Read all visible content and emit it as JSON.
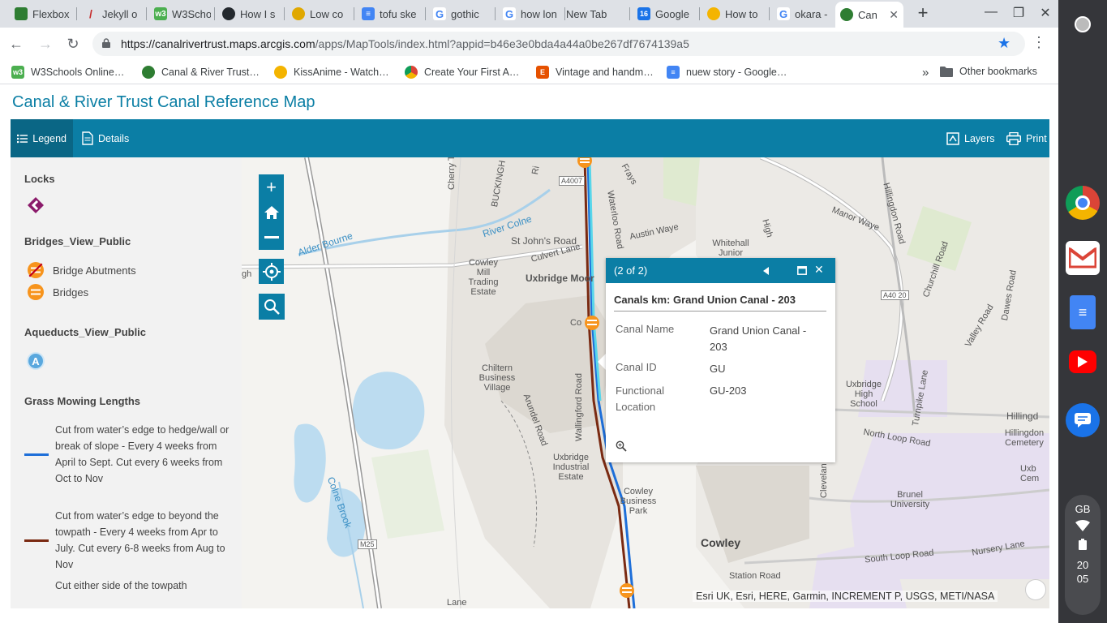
{
  "browser": {
    "tabs": [
      {
        "label": "Flexbox",
        "favicon_color": "#2e7d32"
      },
      {
        "label": "Jekyll o",
        "favicon_color": "#c62828"
      },
      {
        "label": "W3Scho",
        "favicon_color": "#4caf50"
      },
      {
        "label": "How I s",
        "favicon_color": "#24292e"
      },
      {
        "label": "Low co",
        "favicon_color": "#e0a800"
      },
      {
        "label": "tofu ske",
        "favicon_color": "#4285f4"
      },
      {
        "label": "gothic",
        "favicon_color": "#ffffff"
      },
      {
        "label": "how lon",
        "favicon_color": "#ffffff"
      },
      {
        "label": "New Tab",
        "favicon_color": ""
      },
      {
        "label": "Google",
        "favicon_color": "#1a73e8"
      },
      {
        "label": "How to",
        "favicon_color": "#f4b400"
      },
      {
        "label": "okara -",
        "favicon_color": "#ffffff"
      },
      {
        "label": "Can",
        "favicon_color": "#2e7d32",
        "active": true
      }
    ],
    "calendar_fav_text": "16",
    "new_tab_symbol": "+",
    "minimize": "—",
    "maximize": "❐",
    "close": "✕",
    "url_host": "https://canalrivertrust.maps.arcgis.com",
    "url_path": "/apps/MapTools/index.html?appid=b46e3e0bda4a44a0be267df7674139a5",
    "bookmarks": [
      {
        "label": "W3Schools Online…",
        "favicon_color": "#4caf50",
        "glyph": "w3"
      },
      {
        "label": "Canal & River Trust…",
        "favicon_color": "#2e7d32",
        "glyph": ""
      },
      {
        "label": "KissAnime - Watch…",
        "favicon_color": "#f4b400",
        "glyph": ""
      },
      {
        "label": "Create Your First A…",
        "favicon_color": "#db4437",
        "glyph": ""
      },
      {
        "label": "Vintage and handm…",
        "favicon_color": "#e65100",
        "glyph": "E"
      },
      {
        "label": "nuew story - Google…",
        "favicon_color": "#4285f4",
        "glyph": ""
      }
    ],
    "overflow": "»",
    "other_bookmarks": "Other bookmarks"
  },
  "app": {
    "title": "Canal & River Trust Canal Reference Map",
    "toolbar": {
      "legend": "Legend",
      "details": "Details",
      "layers": "Layers",
      "print": "Print"
    }
  },
  "legend": {
    "locks_heading": "Locks",
    "bridges_heading": "Bridges_View_Public",
    "bridge_abutments": "Bridge Abutments",
    "bridges": "Bridges",
    "aqueducts_heading": "Aqueducts_View_Public",
    "aqueduct_symbol": "A",
    "mowing_heading": "Grass Mowing Lengths",
    "mowing_items": [
      {
        "label": "Cut from water’s edge to hedge/wall or break of slope - Every 4 weeks from April to Sept. Cut every 6 weeks from Oct to Nov",
        "color": "#1e6fd9"
      },
      {
        "label": "Cut from water’s edge to beyond the towpath - Every 4 weeks from Apr to July. Cut every 6-8 weeks from Aug to Nov",
        "color": "#7a2a12"
      },
      {
        "label": "Cut either side of the towpath",
        "color": ""
      }
    ]
  },
  "map": {
    "labels": {
      "cherry_tree_lane": "Cherry Tree Lane",
      "buckingham": "BUCKINGH",
      "river_colne": "River Colne",
      "alder_bourne": "Alder Bourne",
      "st_johns_road": "St John's Road",
      "culvert_lane": "Culvert Lane",
      "cowley_mill": "Cowley Mill Trading Estate",
      "uxbridge_moor": "Uxbridge Moor",
      "chiltern": "Chiltern Business Village",
      "arundel_road": "Arundel Road",
      "wallingford_road": "Wallingford Road",
      "uxbridge_ind": "Uxbridge Industrial Estate",
      "cowley_bp": "Cowley Business Park",
      "cowley": "Cowley",
      "colne_brook": "Colne Brook",
      "m25": "M25",
      "a4007": "A4007",
      "a4020": "A40 20",
      "waterloo_road": "Waterloo Road",
      "austin_waye": "Austin Waye",
      "whitehall": "Whitehall Junior",
      "manor_waye": "Manor Waye",
      "hillingdon_road": "Hillingdon Road",
      "churchill_road": "Churchill Road",
      "valley_road": "Valley Road",
      "dawes_road": "Dawes Road",
      "uxbridge_high": "Uxbridge High School",
      "turnpike_lane": "Turnpike Lane",
      "north_loop": "North Loop Road",
      "hillingdon_cem": "Hillingdon Cemetery",
      "uxb_cem": "Uxb Cem",
      "hillingd": "Hillingd",
      "brunel": "Brunel University",
      "south_loop": "South Loop Road",
      "nursery_lane": "Nursery Lane",
      "station_road": "Station Road",
      "cleveland": "Clevelan",
      "fray_s": "Frays",
      "high_rd": "High",
      "ri": "Ri",
      "gh": "gh",
      "lane": "Lane",
      "cow": "Co"
    },
    "attribution": "Esri UK, Esri, HERE, Garmin, INCREMENT P, USGS, METI/NASA",
    "popup": {
      "counter": "(2 of 2)",
      "title": "Canals km: Grand Union Canal - 203",
      "fields": [
        {
          "name": "Canal Name",
          "value": "Grand Union Canal - 203"
        },
        {
          "name": "Canal ID",
          "value": "GU"
        },
        {
          "name": "Functional Location",
          "value": "GU-203"
        }
      ]
    }
  },
  "os": {
    "locale": "GB",
    "time_hour": "20",
    "time_min": "05"
  }
}
